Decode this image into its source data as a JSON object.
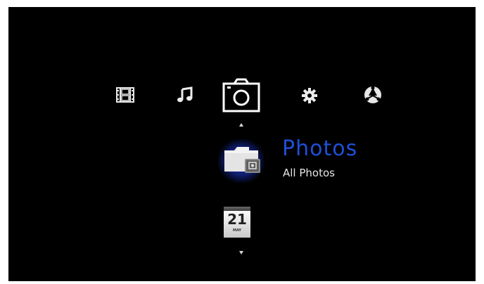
{
  "menu": {
    "categories": [
      {
        "icon": "film-icon",
        "selected": false
      },
      {
        "icon": "music-note-icon",
        "selected": false
      },
      {
        "icon": "camera-icon",
        "selected": true
      },
      {
        "icon": "gear-icon",
        "selected": false
      },
      {
        "icon": "globe-icon",
        "selected": false
      }
    ]
  },
  "selected_item": {
    "icon": "photo-folder-icon",
    "title": "Photos",
    "subtitle": "All Photos"
  },
  "next_item": {
    "icon": "calendar-icon",
    "day": "21",
    "month": "MAY"
  },
  "colors": {
    "background": "#000000",
    "title": "#1f4fd9",
    "subtitle": "#e6e6e6",
    "highlight_glow": "#2846c8"
  }
}
